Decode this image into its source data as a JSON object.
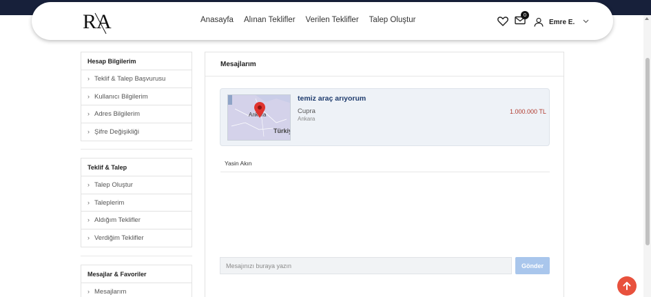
{
  "header": {
    "logo_text": "RA",
    "nav": [
      "Anasayfa",
      "Alınan Teklifler",
      "Verilen Teklifler",
      "Talep Oluştur"
    ],
    "messages_badge": "0",
    "user_name": "Emre E."
  },
  "sidebar": {
    "sections": [
      {
        "title": "Hesap Bilgilerim",
        "items": [
          "Teklif & Talep Başvurusu",
          "Kullanıcı Bilgilerim",
          "Adres Bilgilerim",
          "Şifre Değişikliği"
        ]
      },
      {
        "title": "Teklif & Talep",
        "items": [
          "Talep Oluştur",
          "Taleplerim",
          "Aldığım Teklifler",
          "Verdiğim Teklifler"
        ]
      },
      {
        "title": "Mesajlar & Favoriler",
        "items": [
          "Mesajlarım"
        ]
      }
    ]
  },
  "main": {
    "title": "Mesajlarım",
    "listing": {
      "title": "temiz araç arıyorum",
      "brand": "Cupra",
      "city": "Ankara",
      "price": "1.000.000 TL",
      "map_labels": {
        "pin_city": "Ankara",
        "country": "Türkiy"
      }
    },
    "chat": {
      "contact_name": "Yasin Akın",
      "input_placeholder": "Mesajınızı buraya yazın",
      "send_label": "Gönder"
    }
  },
  "colors": {
    "navy": "#17203a",
    "accent_price": "#b03a2e",
    "send_button": "#a9c6ec",
    "back_to_top": "#e8513d"
  },
  "icons": [
    "heart-icon",
    "envelope-icon",
    "user-icon",
    "chevron-down-icon",
    "chevron-right-icon",
    "map-pin-icon",
    "arrow-up-icon"
  ]
}
